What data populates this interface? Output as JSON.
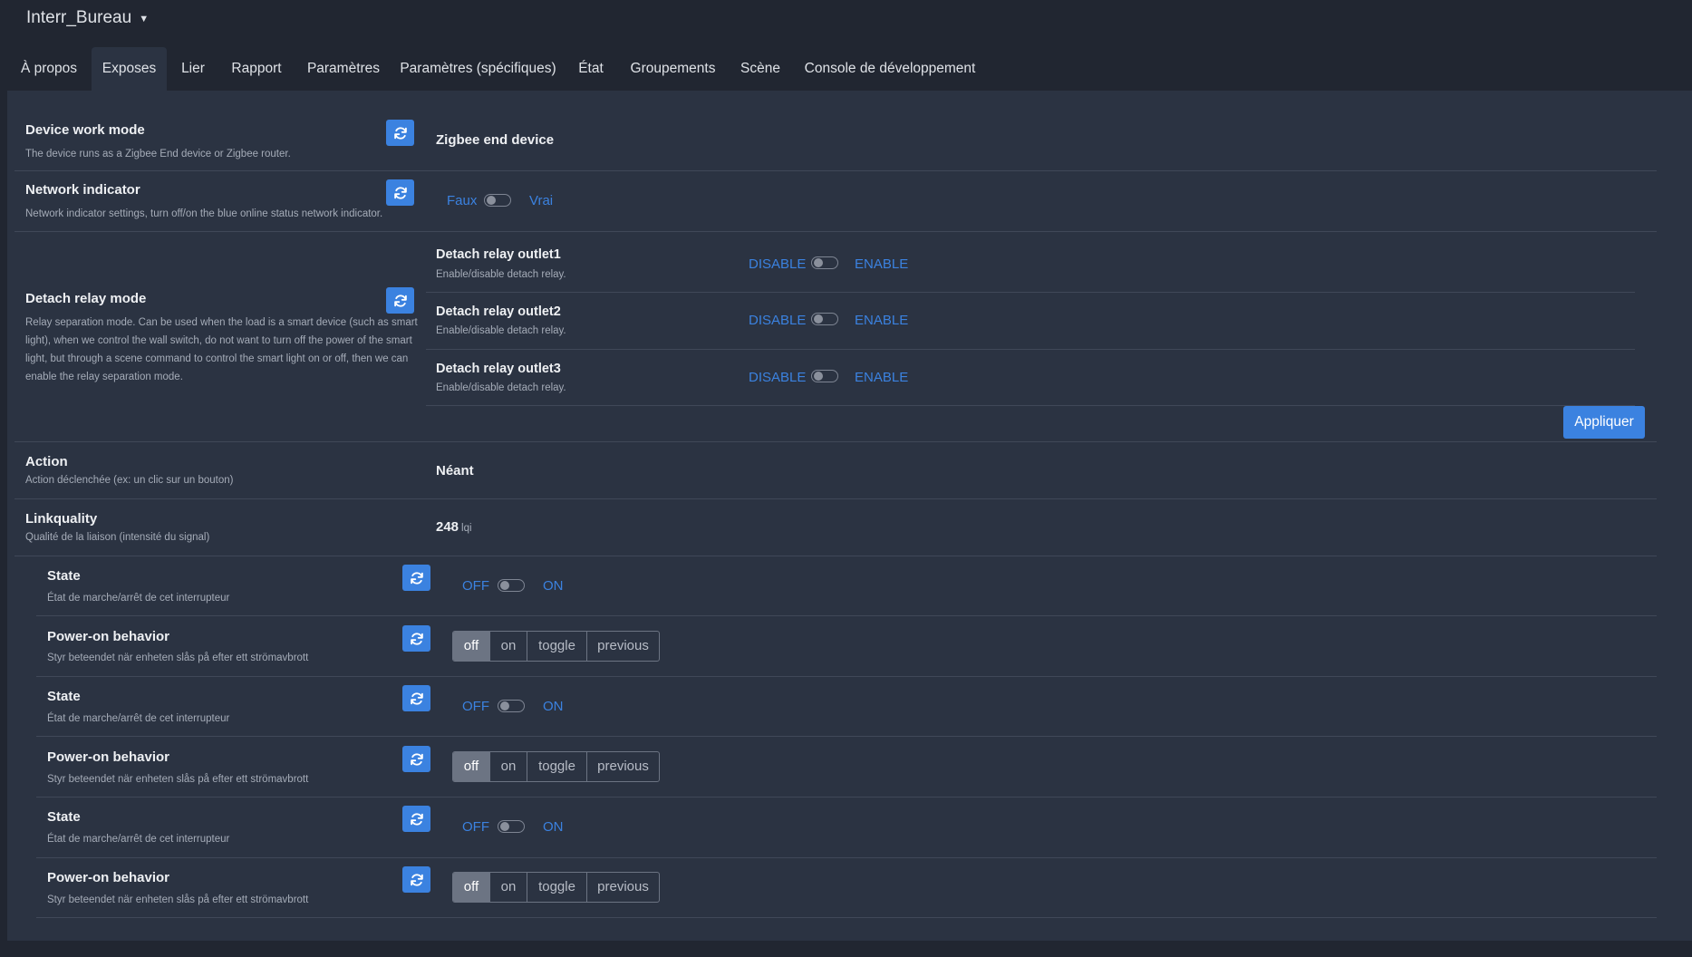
{
  "device": {
    "name": "Interr_Bureau"
  },
  "tabs": [
    "À propos",
    "Exposes",
    "Lier",
    "Rapport",
    "Paramètres",
    "Paramètres (spécifiques)",
    "État",
    "Groupements",
    "Scène",
    "Console de développement"
  ],
  "work_mode": {
    "title": "Device work mode",
    "description": "The device runs as a Zigbee End device or Zigbee router.",
    "value": "Zigbee end device"
  },
  "network_indicator": {
    "title": "Network indicator",
    "description": "Network indicator settings, turn off/on the blue online status network indicator.",
    "off_label": "Faux",
    "on_label": "Vrai"
  },
  "detach_relay": {
    "title": "Detach relay mode",
    "description": "Relay separation mode. Can be used when the load is a smart device (such as smart light), when we control the wall switch, do not want to turn off the power of the smart light, but through a scene command to control the smart light on or off, then we can enable the relay separation mode.",
    "outlets": [
      {
        "title": "Detach relay outlet1",
        "description": "Enable/disable detach relay.",
        "off_label": "DISABLE",
        "on_label": "ENABLE"
      },
      {
        "title": "Detach relay outlet2",
        "description": "Enable/disable detach relay.",
        "off_label": "DISABLE",
        "on_label": "ENABLE"
      },
      {
        "title": "Detach relay outlet3",
        "description": "Enable/disable detach relay.",
        "off_label": "DISABLE",
        "on_label": "ENABLE"
      }
    ],
    "apply_label": "Appliquer"
  },
  "action": {
    "title": "Action",
    "description": "Action déclenchée (ex: un clic sur un bouton)",
    "value": "Néant"
  },
  "linkquality": {
    "title": "Linkquality",
    "description": "Qualité de la liaison (intensité du signal)",
    "value": "248",
    "unit": "lqi"
  },
  "endpoints": [
    {
      "state": {
        "title": "State",
        "description": "État de marche/arrêt de cet interrupteur",
        "off_label": "OFF",
        "on_label": "ON"
      },
      "power_on": {
        "title": "Power-on behavior",
        "description": "Styr beteendet när enheten slås på efter ett strömavbrott",
        "options": [
          "off",
          "on",
          "toggle",
          "previous"
        ],
        "selected": "off"
      }
    },
    {
      "state": {
        "title": "State",
        "description": "État de marche/arrêt de cet interrupteur",
        "off_label": "OFF",
        "on_label": "ON"
      },
      "power_on": {
        "title": "Power-on behavior",
        "description": "Styr beteendet när enheten slås på efter ett strömavbrott",
        "options": [
          "off",
          "on",
          "toggle",
          "previous"
        ],
        "selected": "off"
      }
    },
    {
      "state": {
        "title": "State",
        "description": "État de marche/arrêt de cet interrupteur",
        "off_label": "OFF",
        "on_label": "ON"
      },
      "power_on": {
        "title": "Power-on behavior",
        "description": "Styr beteendet när enheten slås på efter ett strömavbrott",
        "options": [
          "off",
          "on",
          "toggle",
          "previous"
        ],
        "selected": "off"
      }
    }
  ]
}
